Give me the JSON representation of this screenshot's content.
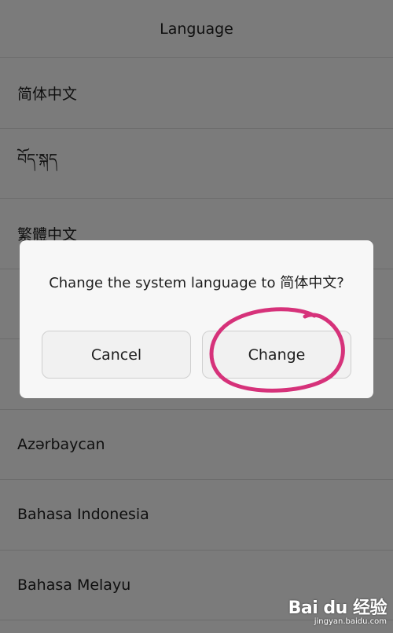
{
  "header": {
    "title": "Language"
  },
  "languages": [
    "简体中文",
    "བོད་སྐད",
    "繁體中文",
    "",
    "",
    "Azərbaycan",
    "Bahasa Indonesia",
    "Bahasa Melayu"
  ],
  "dialog": {
    "message": "Change the system language to 简体中文?",
    "cancel_label": "Cancel",
    "change_label": "Change"
  },
  "annotation": {
    "color": "#d6327a"
  },
  "watermark": {
    "logo_text": "Bai du 经验",
    "url": "jingyan.baidu.com"
  }
}
